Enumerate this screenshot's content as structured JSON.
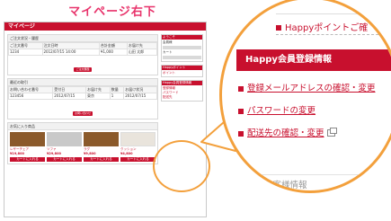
{
  "caption": "マイページ右下",
  "mini_page": {
    "header_title": "マイページ",
    "sections": [
      {
        "title": "ご注文状況・履歴",
        "columns": [
          "ご注文番号",
          "注文日時",
          "合計金額",
          "お届け先"
        ],
        "row": [
          "1234",
          "2012/07/15 14:00",
          "¥1,000",
          "山田 太郎"
        ],
        "button": "ご注文履歴"
      },
      {
        "title": "最近の取引",
        "columns": [
          "お問い合わせ番号",
          "受付日",
          "お届け先",
          "数量",
          "お届け状況"
        ],
        "row": [
          "123456",
          "2012/07/15",
          "東京",
          "1",
          "2012/07/15"
        ],
        "button": "お問い合わせ"
      },
      {
        "title": "お気に入り商品"
      }
    ],
    "favorites": [
      {
        "name": "レザーチェア",
        "price": "¥19,800",
        "button": "カートに入れる"
      },
      {
        "name": "ソファ",
        "price": "¥29,800",
        "button": "カートに入れる"
      },
      {
        "name": "ラグ",
        "price": "¥9,800",
        "button": "カートに入れる"
      },
      {
        "name": "クッション",
        "price": "¥4,800",
        "button": "カートに入れる"
      }
    ],
    "right_boxes": [
      {
        "title": "ようこそ",
        "lines": [
          "会員様",
          "カート"
        ]
      },
      {
        "title": "Happyポイント",
        "lines": [
          "ポイント"
        ]
      },
      {
        "title": "Happy会員登録情報",
        "lines": [
          "登録情報",
          "パスワード",
          "配送先"
        ]
      }
    ]
  },
  "zoom": {
    "top_link": "Happyポイントご確",
    "section_title": "Happy会員登録情報",
    "links": [
      "登録メールアドレスの確認・変更",
      "パスワードの変更",
      "配送先の確認・変更"
    ],
    "bottom_text": "他のお客様情報"
  },
  "colors": {
    "accent": "#c8102e",
    "highlight": "#f3a03c",
    "caption": "#e8336b"
  }
}
